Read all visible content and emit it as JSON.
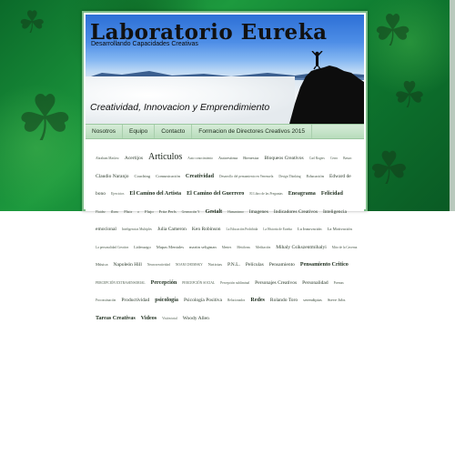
{
  "site": {
    "title": "Laboratorio Eureka",
    "description": "Desarrollando Capacidades Creativas",
    "tagline": "Creatividad, Innovacion y Emprendimiento"
  },
  "nav": {
    "items": [
      {
        "label": "Nosotros"
      },
      {
        "label": "Equipo"
      },
      {
        "label": "Contacto"
      },
      {
        "label": "Formacion de Directores Creativos 2015"
      }
    ]
  },
  "tag_cloud": {
    "tags": [
      {
        "label": "Abraham Maslow",
        "size": 1
      },
      {
        "label": "Acertijos",
        "size": 3
      },
      {
        "label": "Articulos",
        "size": 5
      },
      {
        "label": "Auto conocimiento",
        "size": 1
      },
      {
        "label": "Autoestima",
        "size": 2
      },
      {
        "label": "Bienestar",
        "size": 2
      },
      {
        "label": "Bloqueos Creativos",
        "size": 3
      },
      {
        "label": "Carl Rogers",
        "size": 1
      },
      {
        "label": "Cerro",
        "size": 1
      },
      {
        "label": "Bastac",
        "size": 1
      },
      {
        "label": "Claudio Naranjo",
        "size": 3
      },
      {
        "label": "Coaching",
        "size": 2
      },
      {
        "label": "Comunicación",
        "size": 2
      },
      {
        "label": "Creatividad",
        "size": 4
      },
      {
        "label": "Desarrollo del pensamiento en Venezuela",
        "size": 1
      },
      {
        "label": "Design Thinking",
        "size": 1
      },
      {
        "label": "Educación",
        "size": 2
      },
      {
        "label": "Edward de bono",
        "size": 3
      },
      {
        "label": "Ejercicios",
        "size": 1
      },
      {
        "label": "El Camino del Artista",
        "size": 4
      },
      {
        "label": "El Camino del Guerrero",
        "size": 4
      },
      {
        "label": "El Libro de las Preguntas",
        "size": 1
      },
      {
        "label": "Eneagrama",
        "size": 4
      },
      {
        "label": "Felicidad",
        "size": 4
      },
      {
        "label": "Fluidez",
        "size": 1
      },
      {
        "label": "flow",
        "size": 2
      },
      {
        "label": "Fluir",
        "size": 2
      },
      {
        "label": "o",
        "size": 1
      },
      {
        "label": "Flujo",
        "size": 2
      },
      {
        "label": "Fritz Perls",
        "size": 2
      },
      {
        "label": "Generación Y",
        "size": 1
      },
      {
        "label": "Gestalt",
        "size": 4
      },
      {
        "label": "Humanismo",
        "size": 1
      },
      {
        "label": "Imagenes",
        "size": 3
      },
      {
        "label": "Indicadores Creativos",
        "size": 3
      },
      {
        "label": "Inteligencia emocional",
        "size": 3
      },
      {
        "label": "Inteligencias Multiples",
        "size": 1
      },
      {
        "label": "Julia Cameron",
        "size": 3
      },
      {
        "label": "Ken Robinson",
        "size": 3
      },
      {
        "label": "La Educación Prohibida",
        "size": 1
      },
      {
        "label": "La Historia de Eureka",
        "size": 1
      },
      {
        "label": "La Innovación",
        "size": 2
      },
      {
        "label": "La Motivación",
        "size": 2
      },
      {
        "label": "La personalidad Creativa",
        "size": 1
      },
      {
        "label": "Liderazgo",
        "size": 2
      },
      {
        "label": "Mapas Mentales",
        "size": 2
      },
      {
        "label": "martin seligman",
        "size": 2
      },
      {
        "label": "Mentes",
        "size": 1
      },
      {
        "label": "Metáforas",
        "size": 1
      },
      {
        "label": "Meditación",
        "size": 1
      },
      {
        "label": "Mihaly Csikszentmihalyi",
        "size": 3
      },
      {
        "label": "Mito de la Caverna",
        "size": 1
      },
      {
        "label": "Música",
        "size": 2
      },
      {
        "label": "Napoleón Hill",
        "size": 3
      },
      {
        "label": "Neurocreatividad",
        "size": 1
      },
      {
        "label": "NOAM CHOMSKY",
        "size": 1
      },
      {
        "label": "Noticias",
        "size": 2
      },
      {
        "label": "P.N.L.",
        "size": 3
      },
      {
        "label": "Películas",
        "size": 3
      },
      {
        "label": "Pensamiento",
        "size": 3
      },
      {
        "label": "Pensamiento Critico",
        "size": 4
      },
      {
        "label": "PERCEPCIÓN EXTRASENSORIAL",
        "size": 1
      },
      {
        "label": "Percepción",
        "size": 4
      },
      {
        "label": "PERCEPCIÓN SOCIAL",
        "size": 1
      },
      {
        "label": "Percepción subliminal",
        "size": 1
      },
      {
        "label": "Personajes Creativos",
        "size": 3
      },
      {
        "label": "Personalidad",
        "size": 3
      },
      {
        "label": "Poemas",
        "size": 1
      },
      {
        "label": "Procrastinación",
        "size": 1
      },
      {
        "label": "Productividad",
        "size": 3
      },
      {
        "label": "psicología",
        "size": 4
      },
      {
        "label": "Psicología Positiva",
        "size": 3
      },
      {
        "label": "Relacionados",
        "size": 1
      },
      {
        "label": "Redes",
        "size": 4
      },
      {
        "label": "Rolando Toro",
        "size": 3
      },
      {
        "label": "serendipias",
        "size": 2
      },
      {
        "label": "Steve Jobs",
        "size": 2
      },
      {
        "label": "Tareas Creativas",
        "size": 4
      },
      {
        "label": "Videos",
        "size": 4
      },
      {
        "label": "Visión total",
        "size": 1
      },
      {
        "label": "Woody Allen",
        "size": 3
      }
    ]
  },
  "colors": {
    "background_green": "#1d9a3e",
    "nav_bar": "#c6e4c9",
    "page_border": "#7fbf8a"
  },
  "icons": {
    "clover": "four-leaf-clover-icon"
  }
}
